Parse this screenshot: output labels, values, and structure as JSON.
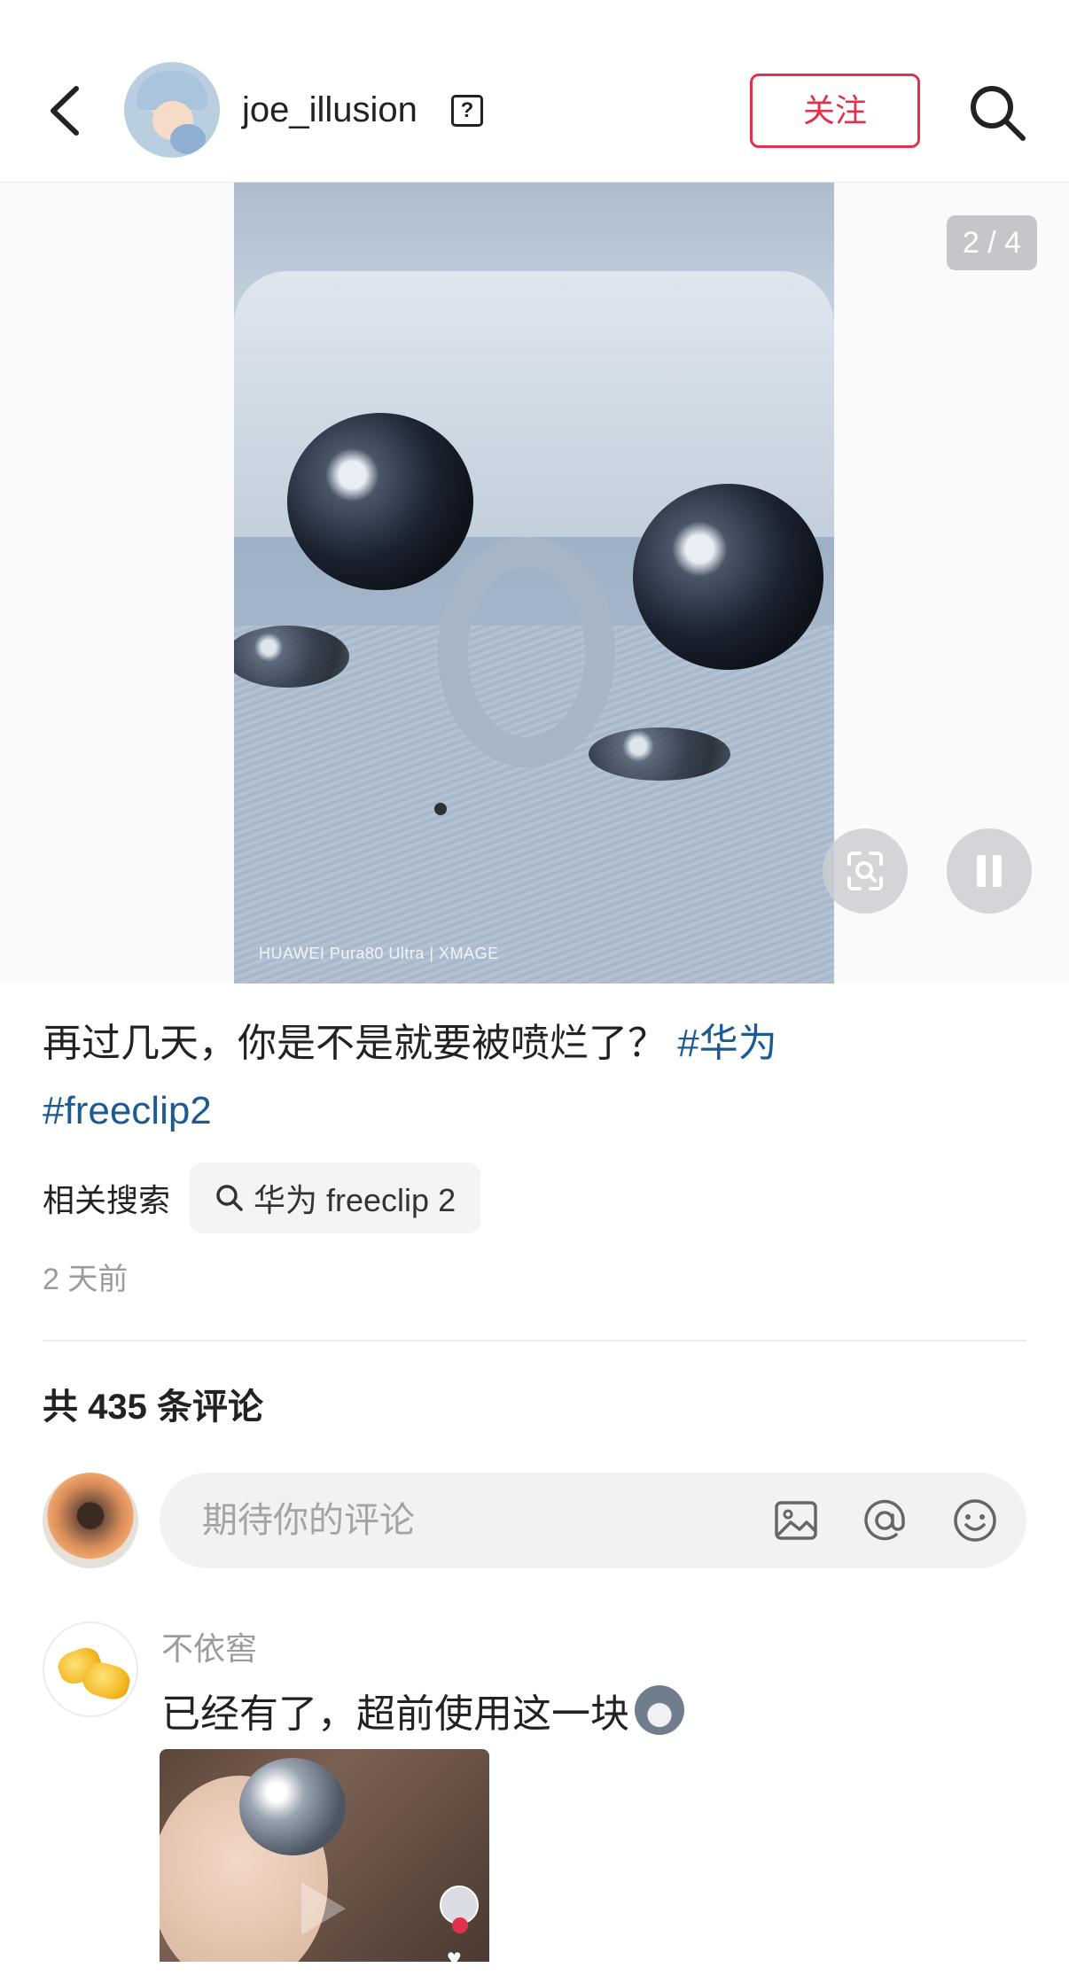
{
  "header": {
    "username": "joe_illusion",
    "help_glyph": "?",
    "follow_label": "关注",
    "icons": [
      "back-arrow-icon",
      "help-icon",
      "search-icon"
    ]
  },
  "media": {
    "page_indicator": "2 / 4",
    "watermark": "HUAWEI Pura80 Ultra | XMAGE",
    "current_page": 2,
    "total_pages": 4,
    "icons": [
      "scan-icon",
      "pause-icon"
    ]
  },
  "post": {
    "caption_text": "再过几天，你是不是就要被喷烂了？",
    "tag1": "#华为",
    "tag2": "#freeclip2",
    "related_label": "相关搜索",
    "related_chip": "华为 freeclip 2",
    "time": "2 天前"
  },
  "comments": {
    "count_label": "共 435 条评论",
    "input_placeholder": "期待你的评论",
    "input_icons": [
      "image-icon",
      "at-icon",
      "emoji-icon"
    ],
    "items": [
      {
        "author": "不依窖",
        "text": "已经有了，超前使用这一块"
      }
    ]
  },
  "colors": {
    "accent": "#e0314d",
    "tag": "#1c5a92",
    "muted": "#9b9b9b",
    "input_bg": "#f2f2f4"
  }
}
